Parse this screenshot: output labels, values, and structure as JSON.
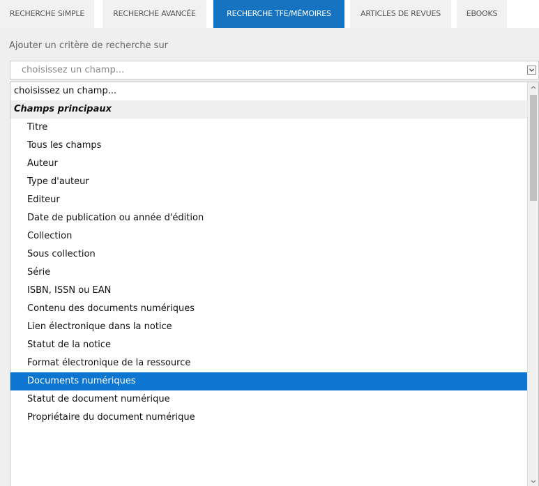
{
  "tabs": [
    {
      "label": "RECHERCHE SIMPLE",
      "active": false
    },
    {
      "label": "RECHERCHE AVANCÉE",
      "active": false
    },
    {
      "label": "RECHERCHE TFE/MÉMOIRES",
      "active": true
    },
    {
      "label": "ARTICLES DE REVUES",
      "active": false
    },
    {
      "label": "EBOOKS",
      "active": false
    }
  ],
  "criterion": {
    "label": "Ajouter un critère de recherche sur",
    "select_value": "choisissez un champ..."
  },
  "dropdown": {
    "placeholder": "choisissez un champ...",
    "group_label": "Champs principaux",
    "options": [
      "Titre",
      "Tous les champs",
      "Auteur",
      "Type d'auteur",
      "Editeur",
      "Date de publication ou année d'édition",
      "Collection",
      "Sous collection",
      "Série",
      "ISBN, ISSN ou EAN",
      "Contenu des documents numériques",
      "Lien électronique dans la notice",
      "Statut de la notice",
      "Format électronique de la ressource",
      "Documents numériques",
      "Statut de document numérique",
      "Propriétaire du document numérique"
    ],
    "selected": "Documents numériques"
  },
  "colors": {
    "accent": "#1673c1",
    "selected_row": "#0d76d0",
    "panel_background": "#efefef"
  },
  "icons": {
    "select_arrow": "chevron-down-icon",
    "scroll_up": "scroll-up-arrow-icon",
    "scroll_down": "scroll-down-arrow-icon"
  }
}
